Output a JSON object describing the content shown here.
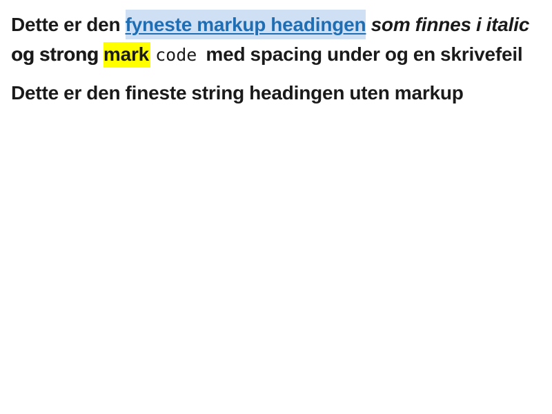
{
  "heading_markup": {
    "part1": "Dette er den ",
    "link": "fyneste markup headingen",
    "part2": " ",
    "italic": "som finnes i italic",
    "part3": " ",
    "strong": "og strong",
    "part4": " ",
    "mark": "mark",
    "part5": " ",
    "code": "code",
    "part6": " med spacing under og en skrivefeil"
  },
  "heading_plain": {
    "text": "Dette er den fineste string headingen uten markup"
  }
}
